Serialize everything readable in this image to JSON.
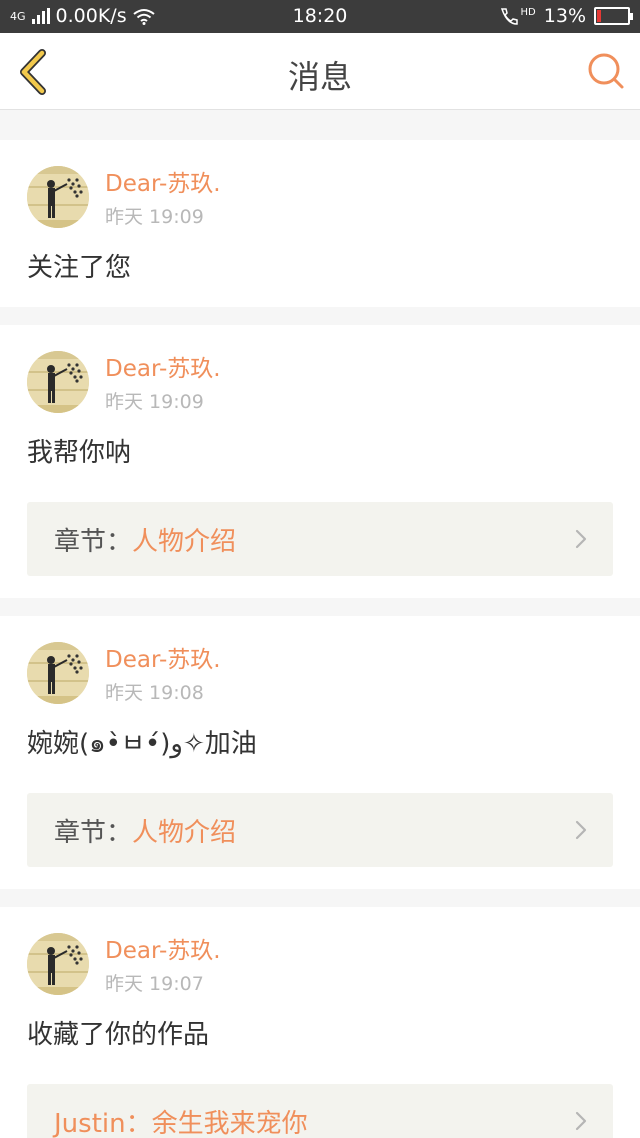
{
  "status": {
    "network": "4G",
    "speed": "0.00K/s",
    "time": "18:20",
    "hd": "HD",
    "battery": "13%",
    "battery_level": 0.13,
    "battery_color": "#e53935"
  },
  "nav": {
    "title": "消息",
    "back_icon": "chevron-left-icon",
    "search_icon": "search-icon"
  },
  "colors": {
    "accent": "#f08f5b",
    "back": "#f2c94c"
  },
  "messages": [
    {
      "user": "Dear-苏玖.",
      "time": "昨天 19:09",
      "text": "关注了您"
    },
    {
      "user": "Dear-苏玖.",
      "time": "昨天 19:09",
      "text": "我帮你呐",
      "ref_key": "章节：",
      "ref_val": "人物介绍"
    },
    {
      "user": "Dear-苏玖.",
      "time": "昨天 19:08",
      "text": "婉婉(๑•̀ㅂ•́)و✧加油",
      "ref_key": "章节：",
      "ref_val": "人物介绍"
    },
    {
      "user": "Dear-苏玖.",
      "time": "昨天 19:07",
      "text": "收藏了你的作品",
      "ref_key": "Justin：",
      "ref_val": "余生我来宠你"
    }
  ]
}
